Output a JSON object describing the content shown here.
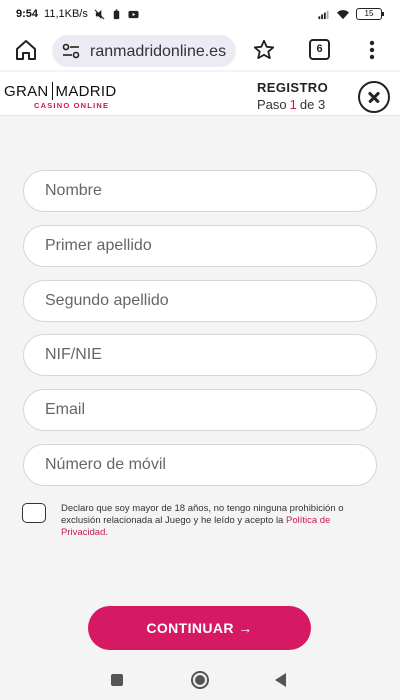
{
  "status_bar": {
    "time": "9:54",
    "speed": "11,1KB/s",
    "battery": "15"
  },
  "browser": {
    "url": "ranmadridonline.es",
    "tab_count": "6"
  },
  "header": {
    "logo_left": "GRAN",
    "logo_right": "MADRID",
    "logo_sub": "CASINO ONLINE",
    "title": "REGISTRO",
    "step_label": "Paso",
    "step_current": "1",
    "step_of": "de 3"
  },
  "form": {
    "fields": [
      {
        "placeholder": "Nombre"
      },
      {
        "placeholder": "Primer apellido"
      },
      {
        "placeholder": "Segundo apellido"
      },
      {
        "placeholder": "NIF/NIE"
      },
      {
        "placeholder": "Email"
      },
      {
        "placeholder": "Número de móvil"
      }
    ],
    "consent_text": "Declaro que soy mayor de 18 años, no tengo ninguna prohibición o exclusión relacionada al Juego y he leído y acepto la",
    "consent_link": "Política de Privacidad",
    "consent_end": ".",
    "continue_label": "CONTINUAR →"
  },
  "colors": {
    "accent": "#d51a63",
    "link": "#c7195f"
  },
  "icons": {
    "home": "home-icon",
    "site_settings": "tune-icon",
    "star": "star-icon",
    "menu": "more-vert-icon",
    "close": "close-icon"
  }
}
